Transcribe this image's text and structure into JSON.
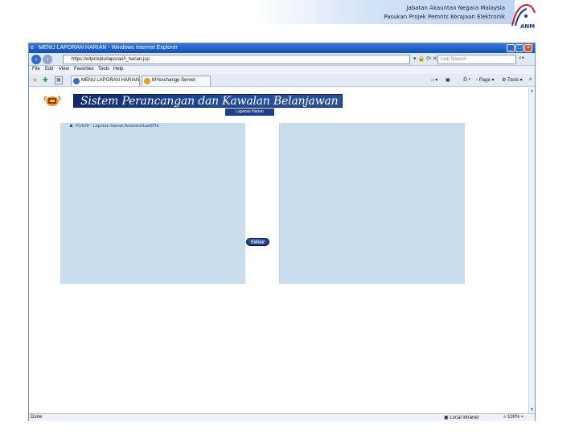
{
  "slide": {
    "line1": "Jabatan Akauntan Negara Malaysia",
    "line2": "Pasukan Projek Pemnts Kerajaan Elektronik",
    "logo_text": "ANM"
  },
  "window": {
    "title": "MENU LAPORAN HARIAN - Windows Internet Explorer",
    "minimize": "_",
    "maximize": "□",
    "close": "×"
  },
  "address_bar": {
    "url": "https://eitpr/eplo/laporan/l_harian.jsp",
    "search_placeholder": "Live Search"
  },
  "menu": [
    "File",
    "Edit",
    "View",
    "Favorites",
    "Tools",
    "Help"
  ],
  "tabs": [
    {
      "label": "MENU LAPORAN HARIAN"
    },
    {
      "label": "MYexchange Server"
    }
  ],
  "command_bar": {
    "page": "Page",
    "tools": "Tools"
  },
  "page": {
    "banner_title": "Sistem Perancangan dan Kawalan Belanjawan",
    "report_tab": "Laporan Harian",
    "list_items": [
      "RV509 - Laporan Harian Anaxsis/Hasil/Ptd"
    ],
    "exit_button": "Keluar"
  },
  "status_bar": {
    "status": "Done",
    "zone": "Local intranet",
    "zoom": "100%"
  },
  "colors": {
    "banner": "#1d3f8c",
    "panel": "#c8dcec",
    "titlebar": "#0f4fb8"
  }
}
